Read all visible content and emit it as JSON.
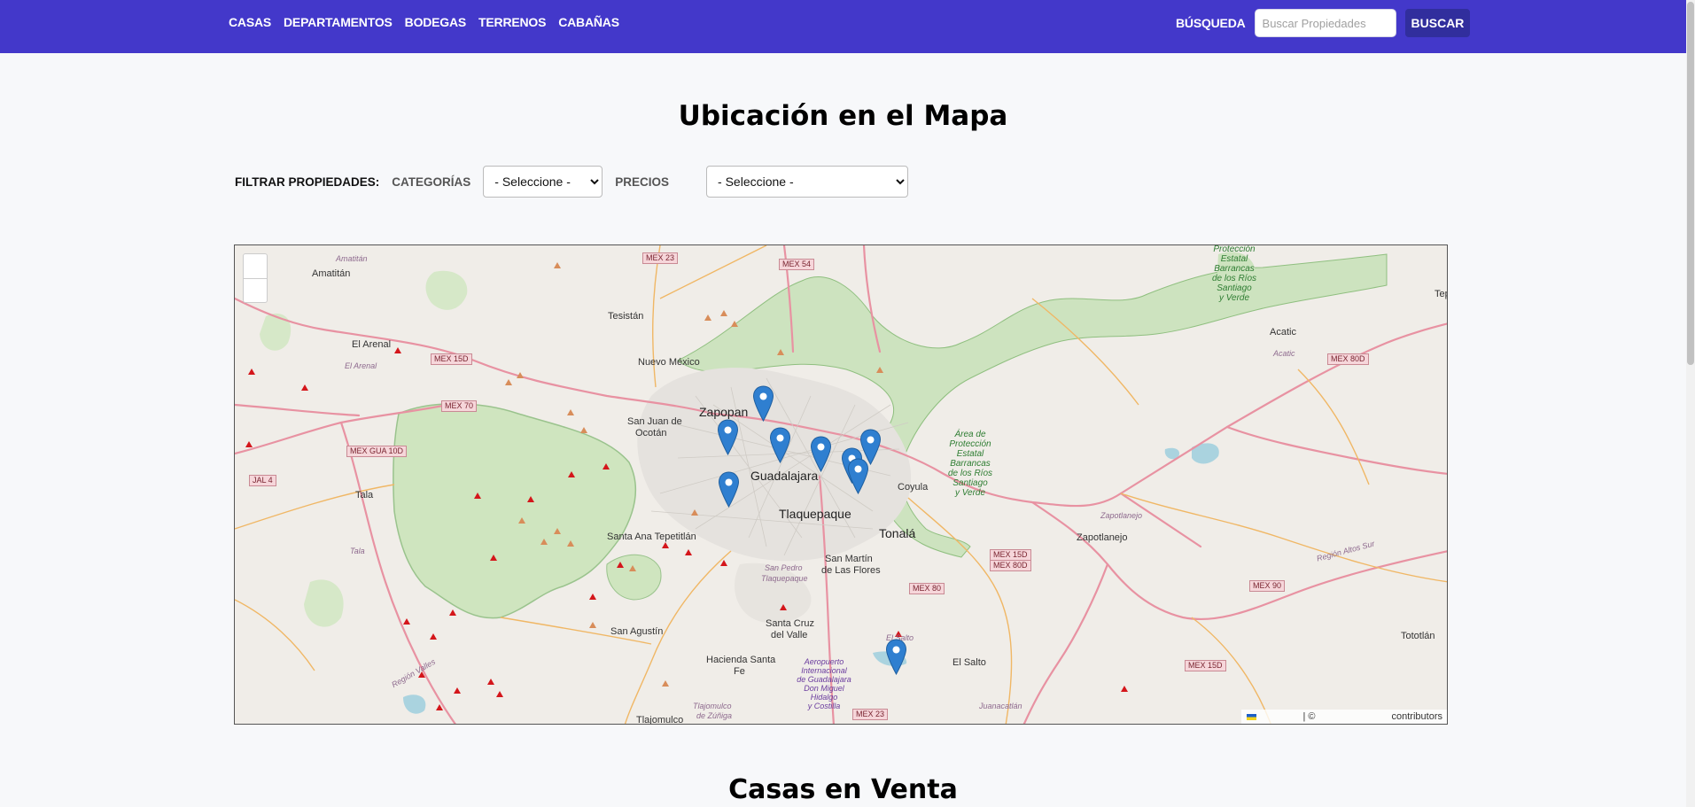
{
  "nav": {
    "links": [
      "CASAS",
      "DEPARTAMENTOS",
      "BODEGAS",
      "TERRENOS",
      "CABAÑAS"
    ],
    "search_label": "BÚSQUEDA",
    "search_placeholder": "Buscar Propiedades",
    "search_button": "BUSCAR"
  },
  "page": {
    "title": "Ubicación en el Mapa",
    "section_title": "Casas en Venta"
  },
  "filters": {
    "label": "FILTRAR PROPIEDADES:",
    "category_label": "CATEGORÍAS",
    "category_value": "- Seleccione -",
    "price_label": "PRECIOS",
    "price_value": "- Seleccione -"
  },
  "map": {
    "attribution_separator": "| ©",
    "attribution_text": "contributors",
    "marker_color": "#2f7fd0",
    "labels": {
      "zapopan": "Zapopan",
      "guadalajara": "Guadalajara",
      "tlaquepaque": "Tlaquepaque",
      "tonala": "Tonalá",
      "amatitan": "Amatitán",
      "amatitan_small": "Amatitán",
      "tesistan": "Tesistán",
      "el_arenal": "El Arenal",
      "el_arenal_small": "El Arenal",
      "nuevo_mexico": "Nuevo México",
      "san_juan_de": "San Juan de",
      "ocotan": "Ocotán",
      "tala": "Tala",
      "tala_small": "Tala",
      "santa_ana": "Santa Ana Tepetitlán",
      "san_pedro": "San Pedro",
      "tlaquepaque_small": "Tlaquepaque",
      "san_martin": "San Martín",
      "de_las_flores": "de Las Flores",
      "coyula": "Coyula",
      "zapotlanejo": "Zapotlanejo",
      "zapotlanejo_small": "Zapotlanejo",
      "acatic": "Acatic",
      "acatic_small": "Acatic",
      "santa_cruz": "Santa Cruz",
      "del_valle": "del Valle",
      "san_agustin": "San Agustín",
      "hacienda_santa": "Hacienda Santa",
      "fe": "Fe",
      "el_salto": "El Salto",
      "el_salto_small": "El Salto",
      "tlajomulco": "Tlajomulco",
      "tlajomulco_small": "Tlajomulco",
      "de_zuniga": "de Zúñiga",
      "juanacatlan": "Juanacatlán",
      "tototlan": "Tototlán",
      "tep": "Tep",
      "region_valles": "Región Valles",
      "region_altos": "Región Altos Sur",
      "park1_l1": "Área de",
      "park1_l2": "Protección",
      "park1_l3": "Estatal",
      "park1_l4": "Barrancas",
      "park1_l5": "de los Ríos",
      "park1_l6": "Santiago",
      "park1_l7": "y Verde",
      "park2_l1": "Protección",
      "park2_l2": "Estatal",
      "park2_l3": "Barrancas",
      "park2_l4": "de los Ríos",
      "park2_l5": "Santiago",
      "park2_l6": "y Verde",
      "airport_l1": "Aeropuerto",
      "airport_l2": "Internacional",
      "airport_l3": "de Guadalajara",
      "airport_l4": "Don Miguel",
      "airport_l5": "Hidalgo",
      "airport_l6": "y Costilla"
    },
    "shields": {
      "mex23_top": "MEX 23",
      "mex54": "MEX 54",
      "mex15d_left": "MEX 15D",
      "mex70": "MEX 70",
      "mexgua10d": "MEX GUA 10D",
      "jal4": "JAL 4",
      "mex80d": "MEX 80D",
      "mex15d_mid": "MEX 15D",
      "mex80d_mid": "MEX 80D",
      "mex80": "MEX 80",
      "mex90": "MEX 90",
      "mex15d_right": "MEX 15D",
      "mex23_bottom": "MEX 23"
    }
  }
}
